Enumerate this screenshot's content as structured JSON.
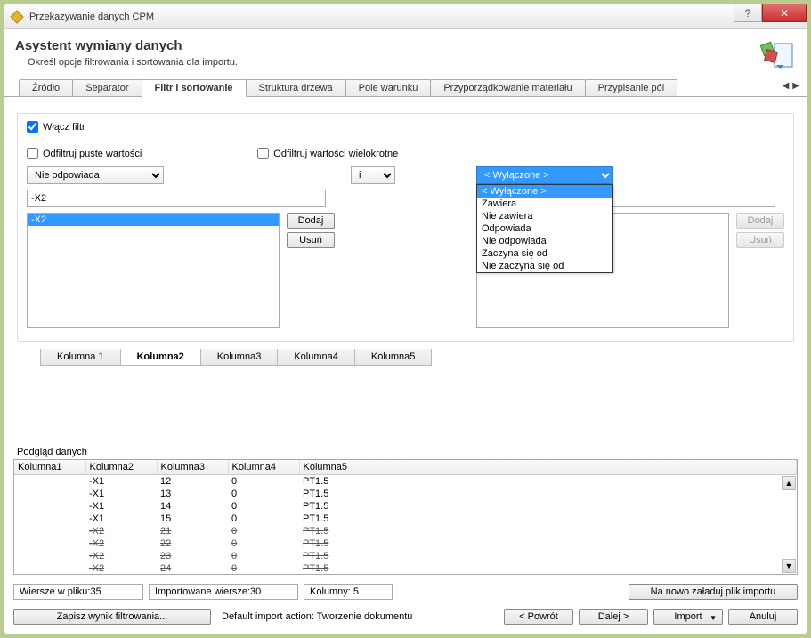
{
  "title": "Przekazywanie danych CPM",
  "header": {
    "heading": "Asystent wymiany danych",
    "subtitle": "Określ opcje filtrowania i sortowania dla importu."
  },
  "tabs": [
    "Źródło",
    "Separator",
    "Filtr i sortowanie",
    "Struktura drzewa",
    "Pole warunku",
    "Przyporządkowanie materiału",
    "Przypisanie pól"
  ],
  "active_tab": "Filtr i sortowanie",
  "filter": {
    "enable_label": "Włącz filtr",
    "filter_empty_label": "Odfiltruj puste wartości",
    "filter_multi_label": "Odfiltruj wartości wielokrotne",
    "left_condition": "Nie odpowiada",
    "left_value": "-X2",
    "left_items": [
      "-X2"
    ],
    "conjunction": "i",
    "right_condition": "< Wyłączone >",
    "right_options": [
      "< Wyłączone >",
      "Zawiera",
      "Nie zawiera",
      "Odpowiada",
      "Nie odpowiada",
      "Zaczyna się od",
      "Nie zaczyna się od"
    ],
    "add_label": "Dodaj",
    "remove_label": "Usuń"
  },
  "subtabs": [
    "Kolumna 1",
    "Kolumna2",
    "Kolumna3",
    "Kolumna4",
    "Kolumna5"
  ],
  "active_subtab": "Kolumna2",
  "preview": {
    "label": "Podgląd danych",
    "headers": [
      "Kolumna1",
      "Kolumna2",
      "Kolumna3",
      "Kolumna4",
      "Kolumna5"
    ],
    "rows": [
      {
        "cells": [
          "",
          "-X1",
          "12",
          "0",
          "PT1.5"
        ],
        "struck": false
      },
      {
        "cells": [
          "",
          "-X1",
          "13",
          "0",
          "PT1.5"
        ],
        "struck": false
      },
      {
        "cells": [
          "",
          "-X1",
          "14",
          "0",
          "PT1.5"
        ],
        "struck": false
      },
      {
        "cells": [
          "",
          "-X1",
          "15",
          "0",
          "PT1.5"
        ],
        "struck": false
      },
      {
        "cells": [
          "",
          "-X2",
          "21",
          "0",
          "PT1.5"
        ],
        "struck": true
      },
      {
        "cells": [
          "",
          "-X2",
          "22",
          "0",
          "PT1.5"
        ],
        "struck": true
      },
      {
        "cells": [
          "",
          "-X2",
          "23",
          "0",
          "PT1.5"
        ],
        "struck": true
      },
      {
        "cells": [
          "",
          "-X2",
          "24",
          "0",
          "PT1.5"
        ],
        "struck": true
      }
    ]
  },
  "status": {
    "rows_in_file": "Wiersze w pliku:35",
    "imported_rows": "Importowane wiersze:30",
    "columns": "Kolumny: 5",
    "reload": "Na nowo załaduj plik importu"
  },
  "footer": {
    "save_filter": "Zapisz wynik filtrowania...",
    "default_action": "Default import action: Tworzenie dokumentu",
    "back": "<  Powrót",
    "next": "Dalej  >",
    "import": "Import",
    "cancel": "Anuluj"
  }
}
